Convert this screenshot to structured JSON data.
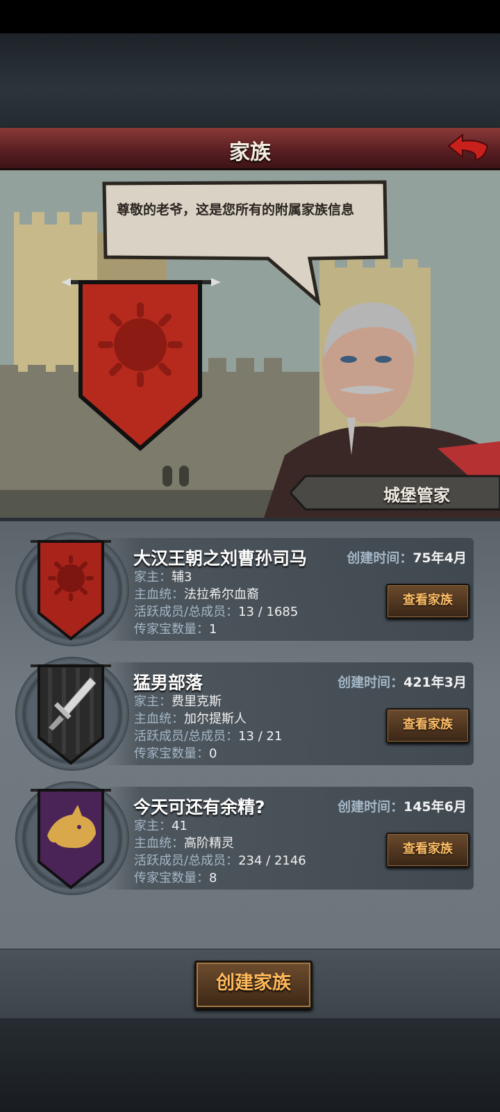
{
  "header": {
    "title": "家族"
  },
  "dialog": {
    "text": "尊敬的老爷，这是您所有的附属家族信息"
  },
  "speaker": {
    "name": "城堡管家"
  },
  "labels": {
    "created": "创建时间：",
    "leader": "家主：",
    "bloodline": "主血统：",
    "members": "活跃成员/总成员：",
    "heirlooms": "传家宝数量：",
    "view_button": "查看家族"
  },
  "families": [
    {
      "name": "大汉王朝之刘曹孙司马",
      "created": "75年4月",
      "leader": "辅3",
      "bloodline": "法拉希尔血裔",
      "members": "13 / 1685",
      "heirlooms": "1",
      "emblem": "sun-icon",
      "banner_color": "#a8231a"
    },
    {
      "name": "猛男部落",
      "created": "421年3月",
      "leader": "费里克斯",
      "bloodline": "加尔提斯人",
      "members": "13 / 21",
      "heirlooms": "0",
      "emblem": "dagger-icon",
      "banner_color": "#2a2a2a"
    },
    {
      "name": "今天可还有余精?",
      "created": "145年6月",
      "leader": "41",
      "bloodline": "高阶精灵",
      "members": "234 / 2146",
      "heirlooms": "8",
      "emblem": "wolf-icon",
      "banner_color": "#4a2456"
    }
  ],
  "footer": {
    "create_button": "创建家族"
  }
}
